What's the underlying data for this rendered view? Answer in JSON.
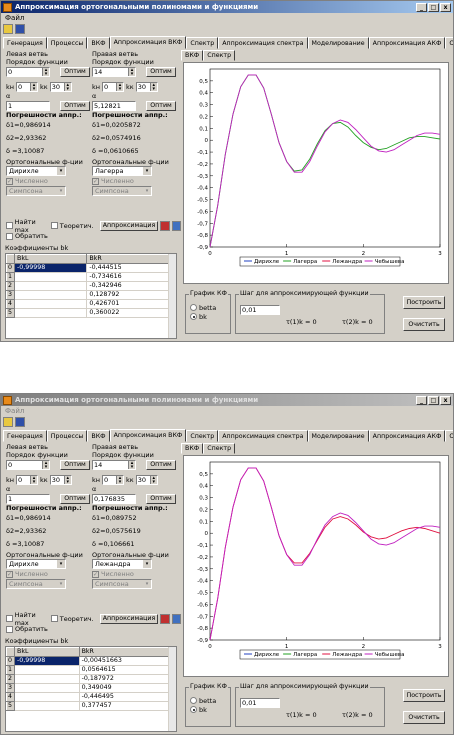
{
  "window_title": "Аппроксимация ортогональными полиномами и функциями",
  "title_buttons": [
    "_",
    "□",
    "x"
  ],
  "menu": [
    "Файл"
  ],
  "tabs": [
    "Генерация",
    "Процессы",
    "ВКФ",
    "Аппроксимация ВКФ",
    "Спектр",
    "Аппроксимация спектра",
    "Моделирование",
    "Аппроксимация АКФ",
    "Ортогона"
  ],
  "active_tab": "Аппроксимация ВКФ",
  "subtabs": [
    "ВКФ",
    "Спектр"
  ],
  "labels": {
    "left_branch": "Левая ветвь",
    "right_branch": "Правая ветвь",
    "order": "Порядок функции",
    "optim": "Оптим",
    "alpha": "α",
    "errors": "Погрешности аппр.:",
    "ortho": "Ортогональные ф-ции",
    "numeric": "Численно",
    "find_max": "Найти max",
    "theoretical": "Теоретич.",
    "reverse": "Обратить",
    "approx_btn": "Аппроксимация",
    "coef_title": "Коэффициенты bk",
    "col_left": "BkL",
    "col_right": "BkR",
    "graph_group": "График КФ",
    "betta": "betta",
    "bk": "bk",
    "step_group": "Шаг для аппроксимирующей функции",
    "step_value": "0,01",
    "tau1": "τ(1)k = 0",
    "tau2": "τ(2)k = 0",
    "build": "Построить",
    "clear": "Очистить",
    "kmin": "kн",
    "kmax": "kк"
  },
  "screens": [
    {
      "id": "top",
      "left": {
        "order": "0",
        "k_lo": "0",
        "k_hi": "30",
        "alpha": "1",
        "d1": "δ1=0,986914",
        "d2": "δ2=2,93362",
        "d": "δ  =3,10087",
        "func": "Дирихле",
        "method": "Симпсона"
      },
      "right": {
        "order": "14",
        "k_lo": "0",
        "k_hi": "30",
        "alpha": "5,12821",
        "d1": "δ1=0,0205872",
        "d2": "δ2=0,0574916",
        "d": "δ  =0,0610665",
        "func": "Лагерра",
        "method": "Симпсона"
      },
      "rows": [
        [
          "0",
          "-0,99998",
          "-0,444515"
        ],
        [
          "1",
          "",
          "-0,734616"
        ],
        [
          "2",
          "",
          "-0,342946"
        ],
        [
          "3",
          "",
          "0,128792"
        ],
        [
          "4",
          "",
          "0,426701"
        ],
        [
          "5",
          "",
          "0,360022"
        ]
      ]
    },
    {
      "id": "bottom",
      "left": {
        "order": "0",
        "k_lo": "0",
        "k_hi": "30",
        "alpha": "1",
        "d1": "δ1=0,986914",
        "d2": "δ2=2,93362",
        "d": "δ  =3,10087",
        "func": "Дирихле",
        "method": "Симпсона"
      },
      "right": {
        "order": "14",
        "k_lo": "0",
        "k_hi": "30",
        "alpha": "0,176835",
        "d1": "δ1=0,089752",
        "d2": "δ2=0,0575619",
        "d": "δ  =0,106661",
        "func": "Лежандра",
        "method": "Симпсона"
      },
      "rows": [
        [
          "0",
          "-0,99998",
          "-0,00451663"
        ],
        [
          "1",
          "",
          "0,0564615"
        ],
        [
          "2",
          "",
          "-0,187972"
        ],
        [
          "3",
          "",
          "0,349049"
        ],
        [
          "4",
          "",
          "-0,446495"
        ],
        [
          "5",
          "",
          "0,377457"
        ]
      ]
    }
  ],
  "chart_data": [
    {
      "type": "line",
      "xlim": [
        0,
        3
      ],
      "ylim": [
        -0.9,
        0.6
      ],
      "xticks": [
        "0",
        "1",
        "2",
        "3"
      ],
      "yticks": [
        "0,5",
        "0,4",
        "0,3",
        "0,2",
        "0,1",
        "0",
        "-0,1",
        "-0,2",
        "-0,3",
        "-0,4",
        "-0,5",
        "-0,6",
        "-0,7",
        "-0,8",
        "-0,9"
      ],
      "legend": [
        "Дирихле",
        "Лагерра",
        "Лежандра",
        "Чебышева"
      ],
      "series": [
        {
          "name": "Лагерра",
          "color": "#22a022",
          "x": [
            0,
            0.1,
            0.2,
            0.3,
            0.4,
            0.5,
            0.6,
            0.7,
            0.8,
            0.9,
            1.0,
            1.1,
            1.2,
            1.3,
            1.4,
            1.5,
            1.6,
            1.7,
            1.8,
            1.9,
            2.0,
            2.1,
            2.2,
            2.3,
            2.4,
            2.5,
            2.6,
            2.7,
            2.8,
            2.9,
            3.0
          ],
          "y": [
            -0.9,
            -0.55,
            -0.12,
            0.22,
            0.45,
            0.55,
            0.55,
            0.44,
            0.22,
            -0.02,
            -0.18,
            -0.26,
            -0.25,
            -0.16,
            -0.03,
            0.08,
            0.14,
            0.15,
            0.11,
            0.04,
            -0.02,
            -0.06,
            -0.08,
            -0.07,
            -0.04,
            -0.01,
            0.02,
            0.03,
            0.03,
            0.02,
            0.01
          ]
        },
        {
          "name": "Чебышева",
          "color": "#c020c0",
          "x": [
            0,
            0.1,
            0.2,
            0.3,
            0.4,
            0.5,
            0.6,
            0.7,
            0.8,
            0.9,
            1.0,
            1.1,
            1.2,
            1.3,
            1.4,
            1.5,
            1.6,
            1.7,
            1.8,
            1.9,
            2.0,
            2.1,
            2.2,
            2.3,
            2.4,
            2.5,
            2.6,
            2.7,
            2.8,
            2.9,
            3.0
          ],
          "y": [
            -0.9,
            -0.55,
            -0.12,
            0.22,
            0.45,
            0.55,
            0.55,
            0.44,
            0.22,
            -0.02,
            -0.18,
            -0.27,
            -0.27,
            -0.18,
            -0.05,
            0.07,
            0.14,
            0.17,
            0.15,
            0.09,
            0.02,
            -0.05,
            -0.09,
            -0.1,
            -0.08,
            -0.04,
            0.0,
            0.04,
            0.06,
            0.06,
            0.05
          ]
        }
      ]
    },
    {
      "type": "line",
      "xlim": [
        0,
        3
      ],
      "ylim": [
        -0.9,
        0.6
      ],
      "xticks": [
        "0",
        "1",
        "2",
        "3"
      ],
      "yticks": [
        "0,5",
        "0,4",
        "0,3",
        "0,2",
        "0,1",
        "0",
        "-0,1",
        "-0,2",
        "-0,3",
        "-0,4",
        "-0,5",
        "-0,6",
        "-0,7",
        "-0,8",
        "-0,9"
      ],
      "legend": [
        "Дирихле",
        "Лагерра",
        "Лежандра",
        "Чебышева"
      ],
      "series": [
        {
          "name": "Лежандра",
          "color": "#e01040",
          "x": [
            0,
            0.1,
            0.2,
            0.3,
            0.4,
            0.5,
            0.6,
            0.7,
            0.8,
            0.9,
            1.0,
            1.1,
            1.2,
            1.3,
            1.4,
            1.5,
            1.6,
            1.7,
            1.8,
            1.9,
            2.0,
            2.1,
            2.2,
            2.3,
            2.4,
            2.5,
            2.6,
            2.7,
            2.8,
            2.9,
            3.0
          ],
          "y": [
            -0.9,
            -0.55,
            -0.12,
            0.22,
            0.45,
            0.55,
            0.55,
            0.44,
            0.22,
            -0.02,
            -0.18,
            -0.25,
            -0.25,
            -0.17,
            -0.06,
            0.05,
            0.12,
            0.14,
            0.12,
            0.07,
            0.01,
            -0.03,
            -0.05,
            -0.04,
            -0.01,
            0.02,
            0.04,
            0.05,
            0.04,
            0.02,
            0.0
          ]
        },
        {
          "name": "Чебышева",
          "color": "#c020c0",
          "x": [
            0,
            0.1,
            0.2,
            0.3,
            0.4,
            0.5,
            0.6,
            0.7,
            0.8,
            0.9,
            1.0,
            1.1,
            1.2,
            1.3,
            1.4,
            1.5,
            1.6,
            1.7,
            1.8,
            1.9,
            2.0,
            2.1,
            2.2,
            2.3,
            2.4,
            2.5,
            2.6,
            2.7,
            2.8,
            2.9,
            3.0
          ],
          "y": [
            -0.9,
            -0.55,
            -0.12,
            0.22,
            0.45,
            0.55,
            0.55,
            0.44,
            0.22,
            -0.02,
            -0.18,
            -0.27,
            -0.27,
            -0.18,
            -0.05,
            0.07,
            0.14,
            0.17,
            0.15,
            0.09,
            0.02,
            -0.05,
            -0.09,
            -0.1,
            -0.08,
            -0.04,
            0.0,
            0.04,
            0.06,
            0.06,
            0.05
          ]
        }
      ]
    }
  ]
}
